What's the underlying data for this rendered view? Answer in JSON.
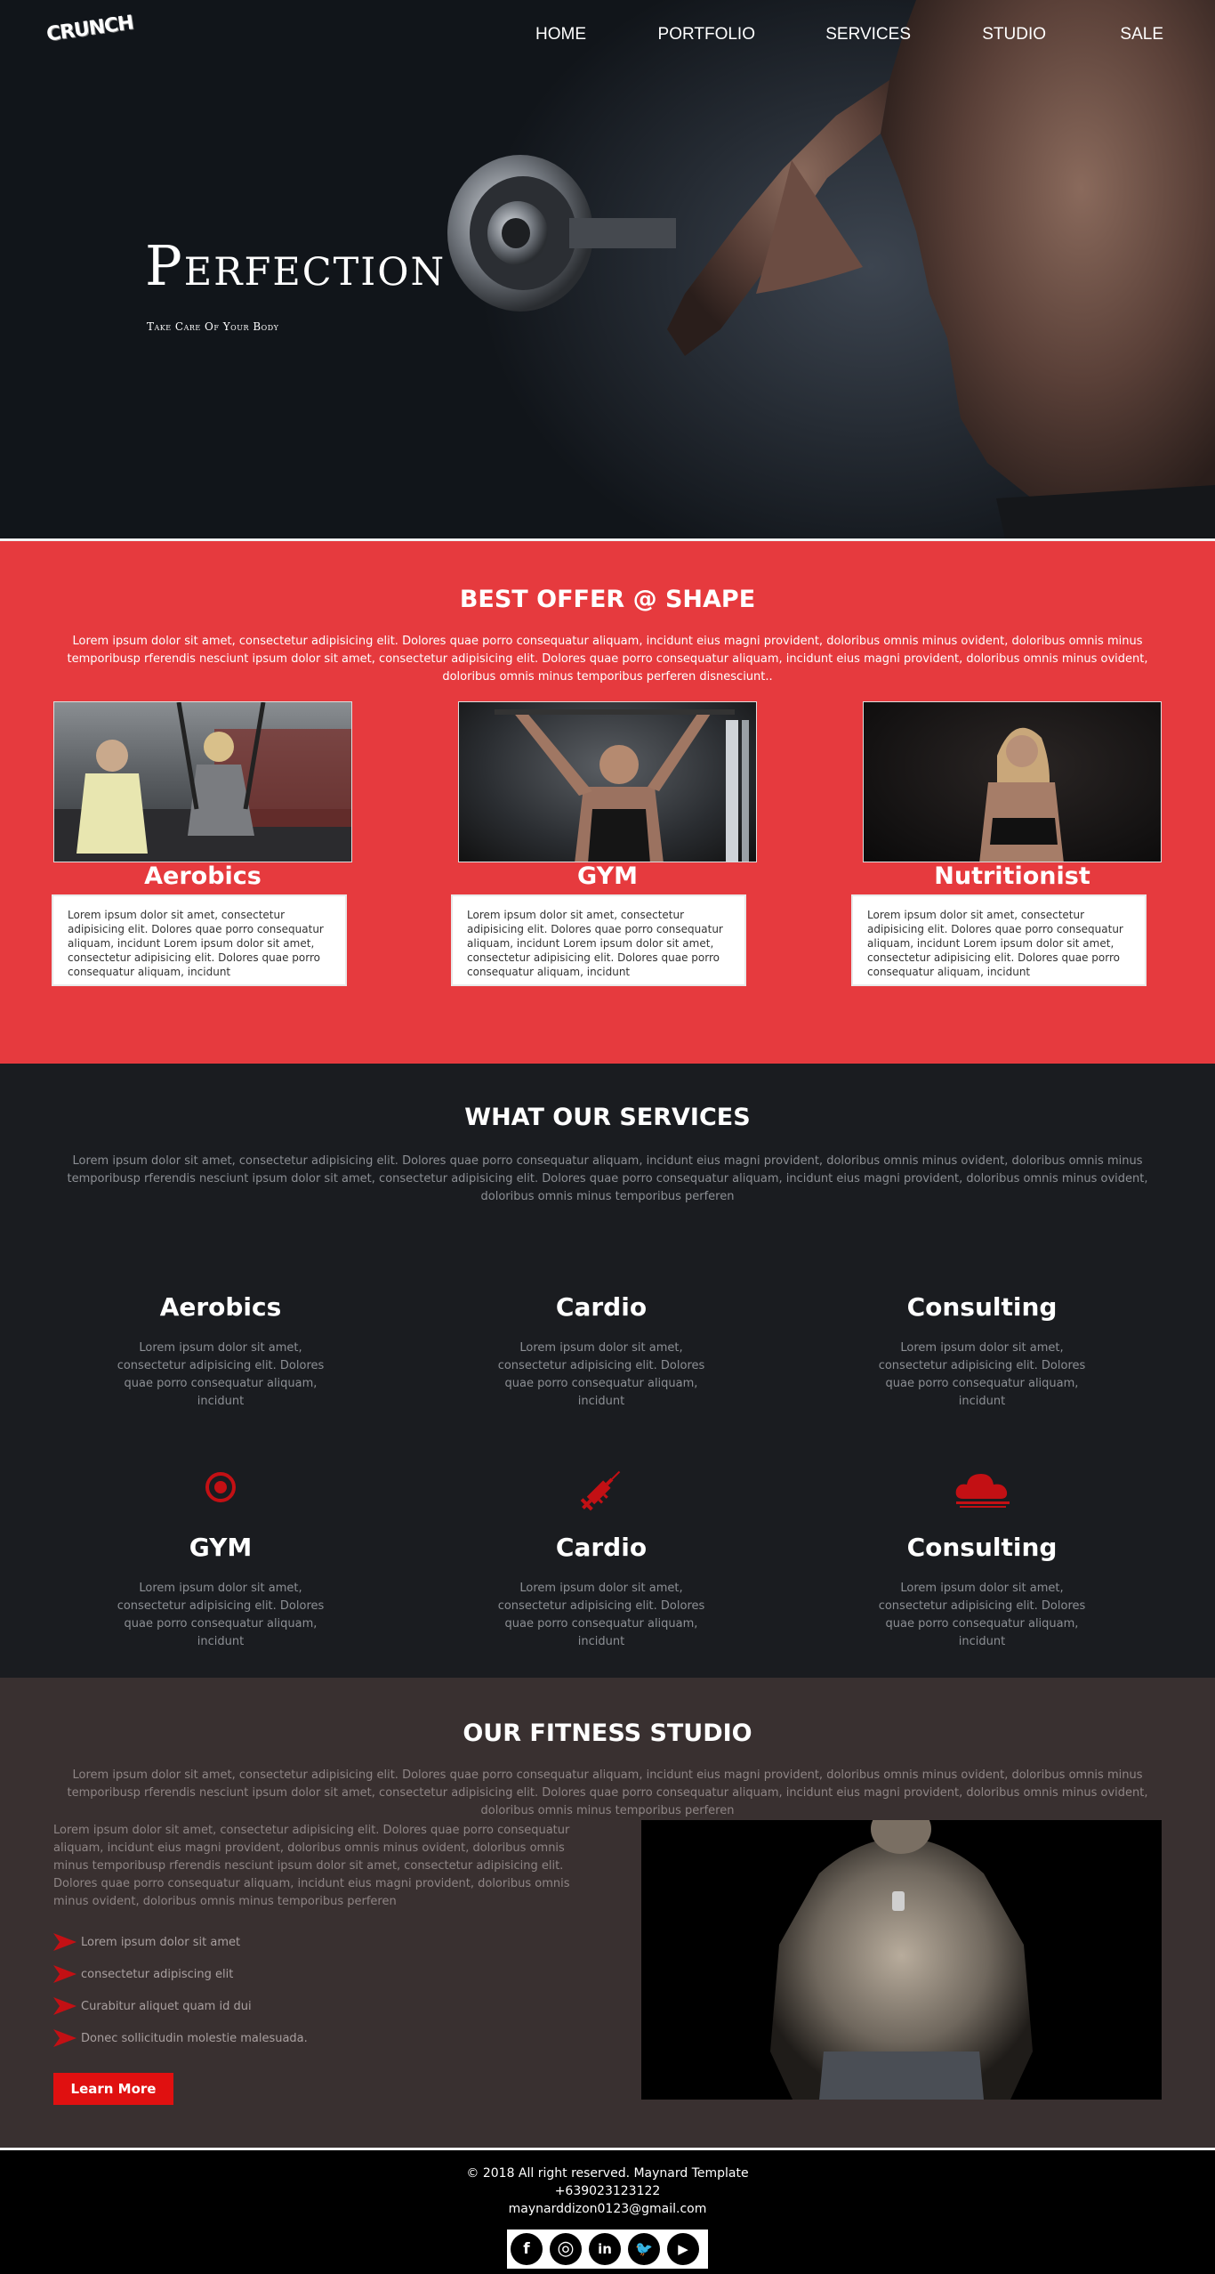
{
  "brand": {
    "logo_text": "CRUNCH"
  },
  "nav": {
    "items": [
      "HOME",
      "PORTFOLIO",
      "SERVICES",
      "STUDIO",
      "SALE"
    ]
  },
  "hero": {
    "title": "Perfection",
    "subtitle": "Take Care Of Your Body"
  },
  "offer": {
    "title": "BEST OFFER @ SHAPE",
    "text": "Lorem ipsum dolor sit amet, consectetur adipisicing elit. Dolores quae porro consequatur aliquam, incidunt eius magni provident, doloribus omnis minus ovident, doloribus omnis minus temporibusp rferendis nesciunt ipsum dolor sit amet, consectetur adipisicing elit. Dolores quae porro consequatur aliquam, incidunt eius magni provident, doloribus omnis minus ovident, doloribus omnis minus temporibus perferen disnesciunt..",
    "cards": [
      {
        "name": "Aerobics",
        "text": "Lorem ipsum dolor sit amet, consectetur adipisicing elit. Dolores quae porro consequatur aliquam, incidunt Lorem ipsum dolor sit amet, consectetur adipisicing elit. Dolores quae porro consequatur aliquam, incidunt"
      },
      {
        "name": "GYM",
        "text": "Lorem ipsum dolor sit amet, consectetur adipisicing elit. Dolores quae porro consequatur aliquam, incidunt Lorem ipsum dolor sit amet, consectetur adipisicing elit. Dolores quae porro consequatur aliquam, incidunt"
      },
      {
        "name": "Nutritionist",
        "text": "Lorem ipsum dolor sit amet, consectetur adipisicing elit. Dolores quae porro consequatur aliquam, incidunt Lorem ipsum dolor sit amet, consectetur adipisicing elit. Dolores quae porro consequatur aliquam, incidunt"
      }
    ]
  },
  "services": {
    "title": "WHAT OUR SERVICES",
    "text": "Lorem ipsum dolor sit amet, consectetur adipisicing elit. Dolores quae porro consequatur aliquam, incidunt eius magni provident, doloribus omnis minus ovident, doloribus omnis minus temporibusp rferendis nesciunt ipsum dolor sit amet, consectetur adipisicing elit. Dolores quae porro consequatur aliquam, incidunt eius magni provident, doloribus omnis minus ovident, doloribus omnis minus temporibus perferen",
    "items": [
      {
        "name": "Aerobics",
        "text": "Lorem ipsum dolor sit amet, consectetur adipisicing elit. Dolores quae porro consequatur aliquam, incidunt"
      },
      {
        "name": "Cardio",
        "text": "Lorem ipsum dolor sit amet, consectetur adipisicing elit. Dolores quae porro consequatur aliquam, incidunt"
      },
      {
        "name": "Consulting",
        "text": "Lorem ipsum dolor sit amet, consectetur adipisicing elit. Dolores quae porro consequatur aliquam, incidunt"
      },
      {
        "name": "GYM",
        "text": "Lorem ipsum dolor sit amet, consectetur adipisicing elit. Dolores quae porro consequatur aliquam, incidunt",
        "icon": "target-icon"
      },
      {
        "name": "Cardio",
        "text": "Lorem ipsum dolor sit amet, consectetur adipisicing elit. Dolores quae porro consequatur aliquam, incidunt",
        "icon": "syringe-icon"
      },
      {
        "name": "Consulting",
        "text": "Lorem ipsum dolor sit amet, consectetur adipisicing elit. Dolores quae porro consequatur aliquam, incidunt",
        "icon": "cloud-icon"
      }
    ]
  },
  "studio": {
    "title": "OUR FITNESS STUDIO",
    "text": "Lorem ipsum dolor sit amet, consectetur adipisicing elit. Dolores quae porro consequatur aliquam, incidunt eius magni provident, doloribus omnis minus ovident, doloribus omnis minus temporibusp rferendis nesciunt ipsum dolor sit amet, consectetur adipisicing elit. Dolores quae porro consequatur aliquam, incidunt eius magni provident, doloribus omnis minus ovident, doloribus omnis minus temporibus perferen",
    "paragraph": "Lorem ipsum dolor sit amet, consectetur adipisicing elit. Dolores quae porro consequatur aliquam, incidunt eius magni provident, doloribus omnis minus ovident, doloribus omnis minus temporibusp rferendis nesciunt ipsum dolor sit amet, consectetur adipisicing elit. Dolores quae porro consequatur aliquam, incidunt eius magni provident, doloribus omnis minus ovident, doloribus omnis minus temporibus perferen",
    "list": [
      "Lorem ipsum dolor sit amet",
      "consectetur adipiscing elit",
      "Curabitur aliquet quam id dui",
      "Donec sollicitudin molestie malesuada."
    ],
    "button": "Learn More"
  },
  "footer": {
    "copyright": "© 2018 All right reserved. Maynard Template",
    "phone": "+639023123122",
    "email": "maynarddizon0123@gmail.com",
    "social": [
      {
        "icon": "facebook-icon",
        "glyph": "f"
      },
      {
        "icon": "instagram-icon",
        "glyph": "◎"
      },
      {
        "icon": "linkedin-icon",
        "glyph": "in"
      },
      {
        "icon": "twitter-icon",
        "glyph": "🐦"
      },
      {
        "icon": "youtube-icon",
        "glyph": "▶"
      }
    ]
  },
  "colors": {
    "accent_red": "#e63a3e",
    "services_bg": "#1a1c20",
    "studio_bg": "#393030",
    "button_red": "#e01010",
    "icon_red": "#c31014"
  }
}
